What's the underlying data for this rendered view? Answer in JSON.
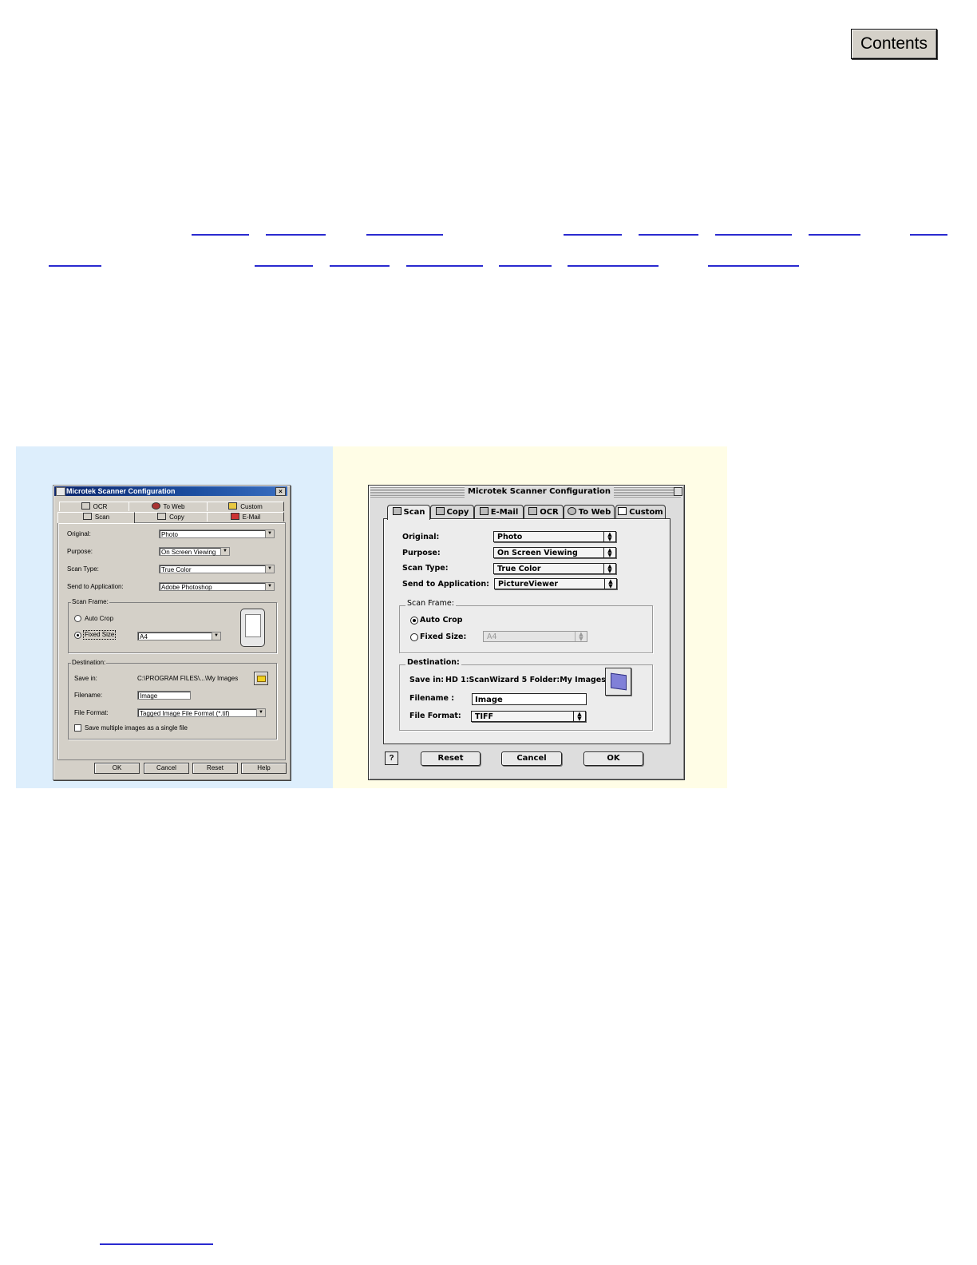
{
  "contents_button": "Contents",
  "windows_dialog": {
    "title": "Microtek Scanner Configuration",
    "close": "×",
    "tabs_back": [
      "OCR",
      "To Web",
      "Custom"
    ],
    "tabs_front": [
      "Scan",
      "Copy",
      "E-Mail"
    ],
    "fields": {
      "original_label": "Original:",
      "original_value": "Photo",
      "purpose_label": "Purpose:",
      "purpose_value": "On Screen Viewing",
      "scantype_label": "Scan Type:",
      "scantype_value": "True Color",
      "sendto_label": "Send to Application:",
      "sendto_value": "Adobe Photoshop"
    },
    "scan_frame": {
      "label": "Scan Frame:",
      "auto_crop": "Auto Crop",
      "fixed_size": "Fixed Size",
      "fixed_value": "A4"
    },
    "destination": {
      "label": "Destination:",
      "save_in_label": "Save in:",
      "save_in_value": "C:\\PROGRAM FILES\\...\\My Images",
      "filename_label": "Filename:",
      "filename_value": "Image",
      "format_label": "File Format:",
      "format_value": "Tagged Image File Format (*.tif)",
      "multi_label": "Save multiple images as a single file"
    },
    "buttons": [
      "OK",
      "Cancel",
      "Reset",
      "Help"
    ]
  },
  "mac_dialog": {
    "title": "Microtek Scanner Configuration",
    "tabs": [
      "Scan",
      "Copy",
      "E-Mail",
      "OCR",
      "To Web",
      "Custom"
    ],
    "fields": {
      "original_label": "Original:",
      "original_value": "Photo",
      "purpose_label": "Purpose:",
      "purpose_value": "On Screen Viewing",
      "scantype_label": "Scan Type:",
      "scantype_value": "True Color",
      "sendto_label": "Send to Application:",
      "sendto_value": "PictureViewer"
    },
    "scan_frame": {
      "label": "Scan Frame:",
      "auto_crop": "Auto Crop",
      "fixed_size": "Fixed Size:",
      "fixed_value": "A4"
    },
    "destination": {
      "label": "Destination:",
      "save_in_label": "Save in:",
      "save_in_value": "HD 1:ScanWizard 5 Folder:My Images:",
      "filename_label": "Filename :",
      "filename_value": "Image",
      "format_label": "File Format:",
      "format_value": "TIFF"
    },
    "help": "?",
    "buttons": [
      "Reset",
      "Cancel",
      "OK"
    ]
  }
}
